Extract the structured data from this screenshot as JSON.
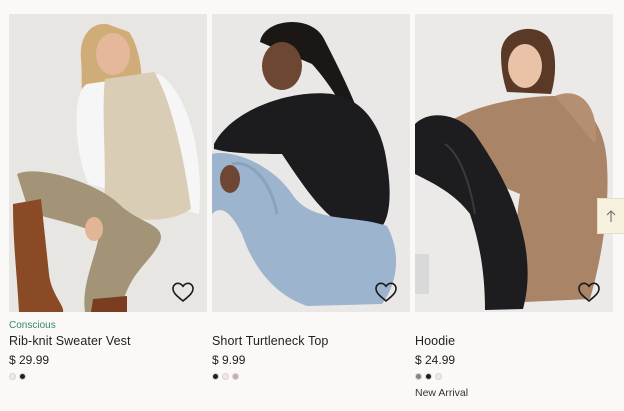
{
  "products": [
    {
      "tag": "Conscious",
      "title": "Rib-knit Sweater Vest",
      "price": "$ 29.99",
      "swatches": [
        "#efe9e0",
        "#1f1f1f"
      ],
      "badge": ""
    },
    {
      "tag": "",
      "title": "Short Turtleneck Top",
      "price": "$ 9.99",
      "swatches": [
        "#1f1f1f",
        "#efe9e0",
        "#c7a9b1"
      ],
      "badge": ""
    },
    {
      "tag": "",
      "title": "Hoodie",
      "price": "$ 24.99",
      "swatches": [
        "#8c8278",
        "#1f1f1f",
        "#efe9e0"
      ],
      "badge": "New Arrival"
    }
  ],
  "icons": {
    "favorite": "heart-icon",
    "scroll": "arrow-up-icon"
  },
  "colors": {
    "conscious_tag": "#2f8d6a",
    "page_background": "#faf9f8"
  }
}
